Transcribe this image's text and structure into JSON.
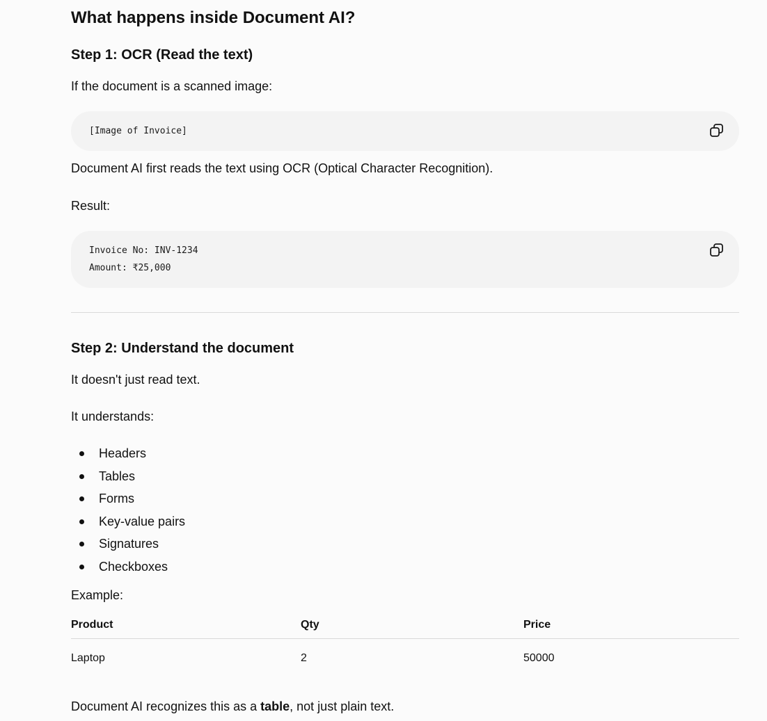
{
  "heading": "What happens inside Document AI?",
  "step1": {
    "title": "Step 1: OCR (Read the text)",
    "intro": "If the document is a scanned image:",
    "code1": "[Image of Invoice]",
    "after": "Document AI first reads the text using OCR (Optical Character Recognition).",
    "result_label": "Result:",
    "code2_line1": "Invoice No: INV-1234",
    "code2_line2": "Amount: ₹25,000"
  },
  "step2": {
    "title": "Step 2: Understand the document",
    "line1": "It doesn't just read text.",
    "line2": "It understands:",
    "items": [
      "Headers",
      "Tables",
      "Forms",
      "Key-value pairs",
      "Signatures",
      "Checkboxes"
    ],
    "example_label": "Example:",
    "table": {
      "headers": [
        "Product",
        "Qty",
        "Price"
      ],
      "rows": [
        [
          "Laptop",
          "2",
          "50000"
        ]
      ]
    },
    "final_before": "Document AI recognizes this as a ",
    "final_bold": "table",
    "final_after": ", not just plain text."
  },
  "icons": {
    "copy": "copy-icon"
  }
}
